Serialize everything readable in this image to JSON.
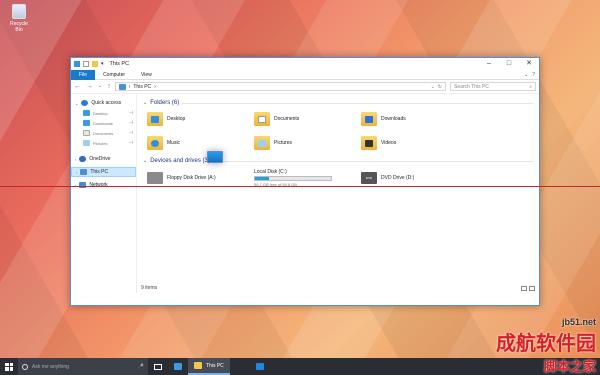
{
  "desktop": {
    "recycle_bin_label": "Recycle Bin"
  },
  "window": {
    "title": "This PC",
    "ribbon_tabs": [
      "File",
      "Computer",
      "View"
    ],
    "nav": {
      "back": "←",
      "forward": "→",
      "down": "⌄",
      "up": "↑"
    },
    "address": {
      "root_arrow": "›",
      "location": "This PC",
      "chevron": "›"
    },
    "search_placeholder": "Search This PC",
    "sidebar": {
      "quick_access": "Quick access",
      "pinned": [
        {
          "label": "Desktop"
        },
        {
          "label": "Downloads"
        },
        {
          "label": "Documents"
        },
        {
          "label": "Pictures"
        }
      ],
      "onedrive": "OneDrive",
      "this_pc": "This PC",
      "network": "Network"
    },
    "folders_header": "Folders (6)",
    "folders": [
      {
        "label": "Desktop",
        "icon": "desktop-icon",
        "emblem_color": "#2f8fe0"
      },
      {
        "label": "Documents",
        "icon": "documents-icon",
        "emblem_color": "#ffffff"
      },
      {
        "label": "Downloads",
        "icon": "downloads-icon",
        "emblem_color": "#2f6fd6"
      },
      {
        "label": "Music",
        "icon": "music-icon",
        "emblem_color": "#2f8fe0"
      },
      {
        "label": "Pictures",
        "icon": "pictures-icon",
        "emblem_color": "#9ecff0"
      },
      {
        "label": "Videos",
        "icon": "videos-icon",
        "emblem_color": "#333333"
      }
    ],
    "drives_header": "Devices and drives (3)",
    "drives": [
      {
        "label": "Floppy Disk Drive (A:)",
        "type": "floppy"
      },
      {
        "label": "Local Disk (C:)",
        "type": "system",
        "used_fraction": 0.18,
        "free_text": "50.7 GB free of 59.8 GB"
      },
      {
        "label": "DVD Drive (D:)",
        "type": "dvd",
        "icon_text": "DVD"
      }
    ],
    "status_text": "9 items"
  },
  "taskbar": {
    "search_placeholder": "Ask me anything",
    "mic": "🎤",
    "active_app": "This PC"
  },
  "watermark": {
    "line1": "成航软件园",
    "line2": "脚本之家",
    "url": "jb51.net"
  },
  "colors": {
    "accent": "#1979ca",
    "selection": "#cce8ff",
    "taskbar": "#2a2d34"
  }
}
